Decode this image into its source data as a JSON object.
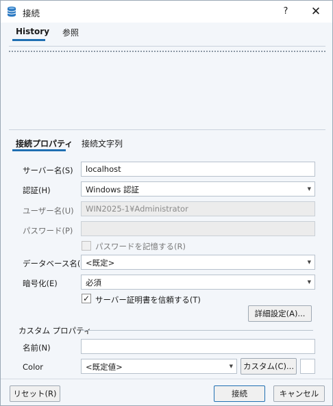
{
  "window": {
    "title": "接続",
    "help_label": "?",
    "close_label": "✕"
  },
  "top_tabs": [
    {
      "label": "History"
    },
    {
      "label": "参照"
    }
  ],
  "conn_tabs": [
    {
      "label": "接続プロパティ"
    },
    {
      "label": "接続文字列"
    }
  ],
  "form": {
    "server_label": "サーバー名(S)",
    "server_value": "localhost",
    "auth_label": "認証(H)",
    "auth_value": "Windows 認証",
    "user_label": "ユーザー名(U)",
    "user_value": "WIN2025-1¥Administrator",
    "password_label": "パスワード(P)",
    "password_value": "",
    "remember_label": "パスワードを記憶する(R)",
    "database_label": "データベース名(D)",
    "database_value": "<既定>",
    "encrypt_label": "暗号化(E)",
    "encrypt_value": "必須",
    "trust_cert_label": "サーバー証明書を信頼する(T)",
    "advanced_button": "詳細設定(A)...",
    "custom_group_label": "カスタム プロパティ",
    "name_label": "名前(N)",
    "name_value": "",
    "color_label": "Color",
    "color_value": "<既定値>",
    "custom_button": "カスタム(C)..."
  },
  "footer": {
    "reset_button": "リセット(R)",
    "connect_button": "接続",
    "cancel_button": "キャンセル"
  },
  "colors": {
    "accent": "#1f6fb2",
    "background": "#f3f6fa",
    "title_icon": "#2b79c2"
  }
}
